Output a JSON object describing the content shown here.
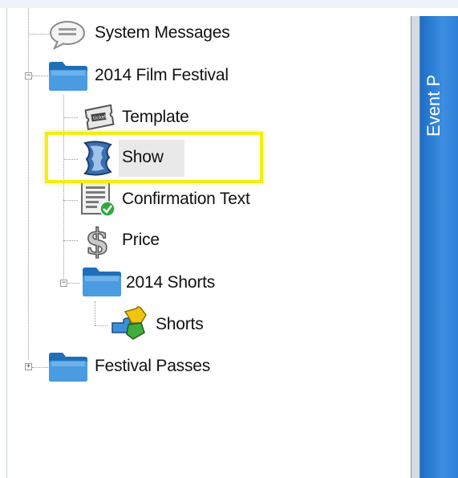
{
  "tree": {
    "items": [
      {
        "label": "System Messages",
        "icon": "speech-bubble-icon"
      },
      {
        "label": "2014 Film Festival",
        "icon": "folder-icon",
        "expanded": true
      },
      {
        "label": "Template",
        "icon": "ticket-icon"
      },
      {
        "label": "Show",
        "icon": "film-strip-icon",
        "selected": true
      },
      {
        "label": "Confirmation Text",
        "icon": "document-check-icon"
      },
      {
        "label": "Price",
        "icon": "dollar-sign-icon"
      },
      {
        "label": "2014 Shorts",
        "icon": "folder-icon",
        "expanded": true
      },
      {
        "label": "Shorts",
        "icon": "puzzle-icon"
      },
      {
        "label": "Festival Passes",
        "icon": "folder-icon",
        "expanded": false
      }
    ]
  },
  "side_panel": {
    "title": "Event P"
  },
  "colors": {
    "highlight": "#f2ee12",
    "panel": "#2d7fd8",
    "folder": "#2f86cf"
  }
}
